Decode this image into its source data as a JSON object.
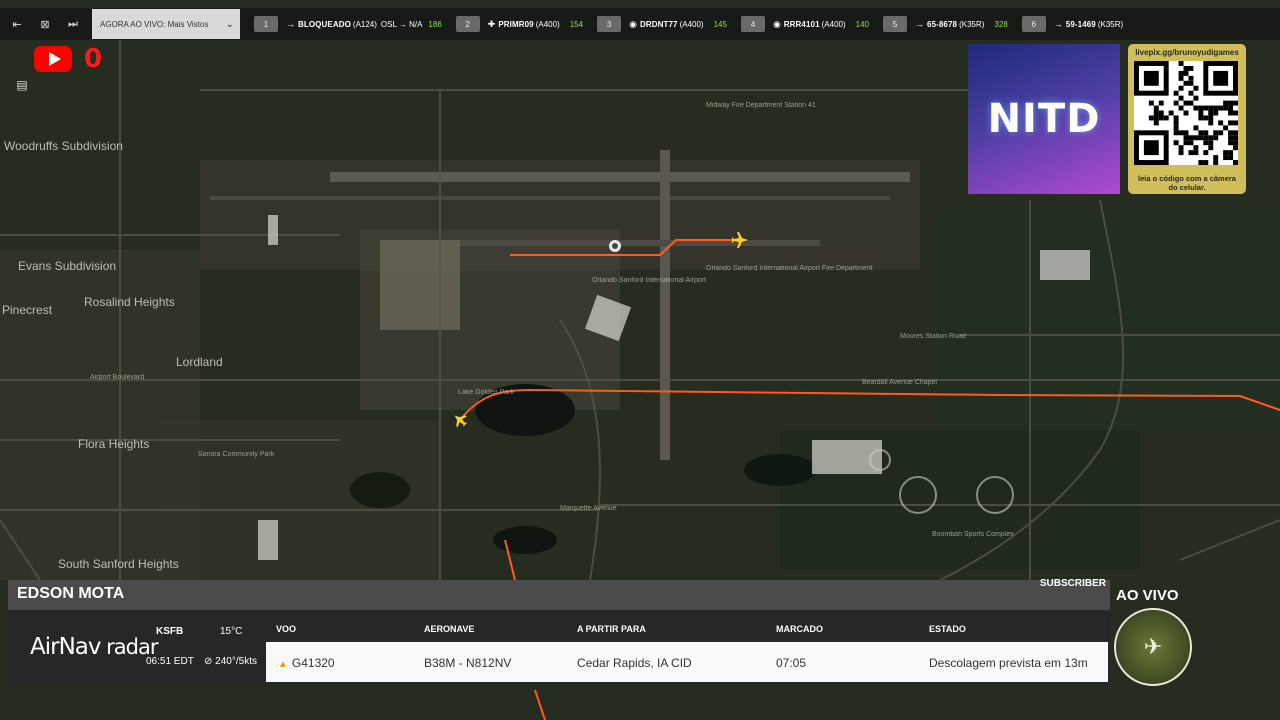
{
  "topbar": {
    "dropdown_label": "AGORA AO VIVO: Mais Vistos",
    "flights": [
      {
        "num": "1",
        "icon": "plane-icon",
        "callsign": "BLOQUEADO",
        "type": "(A124)",
        "route": "OSL → N/A",
        "alt": "186"
      },
      {
        "num": "2",
        "icon": "helicopter-icon",
        "callsign": "PRIMR09",
        "type": "(A400)",
        "route": "",
        "alt": "154"
      },
      {
        "num": "3",
        "icon": "target-icon",
        "callsign": "DRDNT77",
        "type": "(A400)",
        "route": "",
        "alt": "145"
      },
      {
        "num": "4",
        "icon": "target-icon",
        "callsign": "RRR4101",
        "type": "(A400)",
        "route": "",
        "alt": "140"
      },
      {
        "num": "5",
        "icon": "plane-icon",
        "callsign": "65-8678",
        "type": "(K35R)",
        "route": "",
        "alt": "328"
      },
      {
        "num": "6",
        "icon": "plane-icon",
        "callsign": "59-1469",
        "type": "(K35R)",
        "route": "",
        "alt": ""
      }
    ]
  },
  "youtube": {
    "count": "0"
  },
  "sponsor": {
    "logo_text": "NITD",
    "qr_url": "livepix.gg/brunoyudigames",
    "qr_caption": "leia o código com a câmera do celular."
  },
  "map": {
    "labels": {
      "l1": "Woodruffs Subdivision",
      "l2": "Evans Subdivision",
      "l3": "Pinecrest",
      "l4": "Rosalind Heights",
      "l5": "Lordland",
      "l6": "Flora Heights",
      "l7": "South Sanford Heights",
      "l8": "Midway Fire Department Station 41",
      "l9": "Orlando Sanford International Airport",
      "l10": "Orlando Sanford International Airport Fire Department",
      "l11": "Beardall Avenue Chapel",
      "l12": "Boombah Sports Complex",
      "l13": "Airport Boulevard",
      "l14": "Marquette Avenue",
      "l15": "Moores Station Road",
      "l16": "Lake Golden Park",
      "l17": "Sanora Community Park"
    }
  },
  "panel": {
    "streamer": "EDSON MOTA",
    "subscriber_label": "SUBSCRIBER",
    "brand_bold": "AirNav",
    "brand_thin": " radar",
    "airport": "KSFB",
    "time": "06:51 EDT",
    "temp": "15°C",
    "wind": "240°/5kts",
    "headers": {
      "flight": "VOO",
      "aircraft": "AERONAVE",
      "route": "A PARTIR PARA",
      "scheduled": "MARCADO",
      "status": "ESTADO"
    },
    "row": {
      "flight": "G41320",
      "aircraft": "B38M - N812NV",
      "route": "Cedar Rapids, IA CID",
      "scheduled": "07:05",
      "status": "Descolagem prevista em 13m"
    }
  },
  "live": {
    "label": "AO VIVO"
  },
  "colors": {
    "track": "#ff5a1f",
    "alt_green": "#8fe04a",
    "youtube": "#ff0000",
    "qr_frame": "#cfbe5a"
  }
}
